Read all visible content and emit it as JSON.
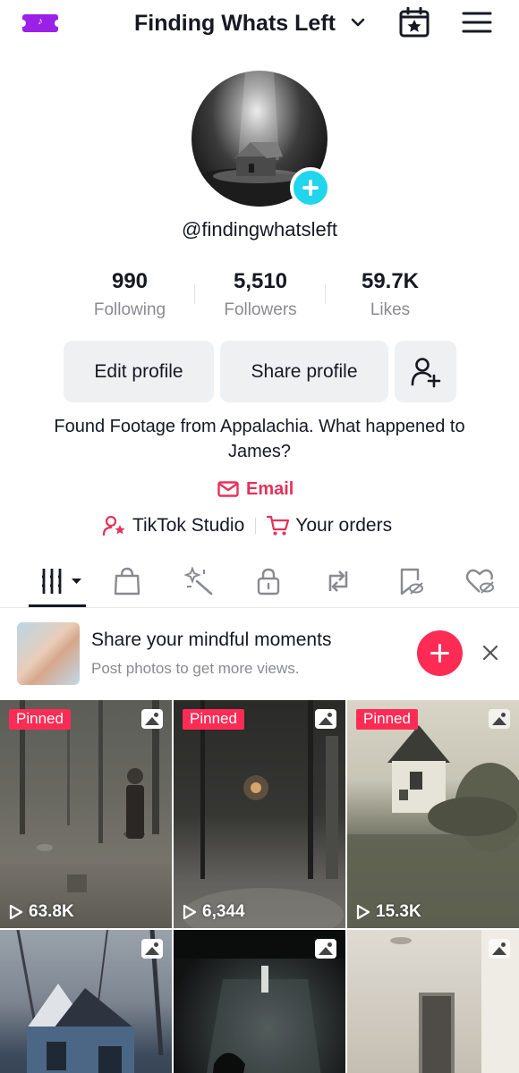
{
  "header": {
    "ticket_glyph": "♪",
    "title": "Finding Whats Left"
  },
  "profile": {
    "handle": "@findingwhatsleft",
    "stats": [
      {
        "value": "990",
        "label": "Following"
      },
      {
        "value": "5,510",
        "label": "Followers"
      },
      {
        "value": "59.7K",
        "label": "Likes"
      }
    ],
    "edit_label": "Edit profile",
    "share_label": "Share profile",
    "bio": "Found Footage from Appalachia. What happened to James?",
    "email_label": "Email",
    "studio_label": "TikTok Studio",
    "orders_label": "Your orders"
  },
  "tabs": [
    "videos-tab",
    "shop-tab",
    "effects-tab",
    "private-tab",
    "reposts-tab",
    "favorites-tab",
    "liked-tab"
  ],
  "banner": {
    "title": "Share your mindful moments",
    "subtitle": "Post photos to get more views."
  },
  "grid": {
    "items": [
      {
        "pinned": "Pinned",
        "views": "63.8K",
        "type": "photo"
      },
      {
        "pinned": "Pinned",
        "views": "6,344",
        "type": "photo"
      },
      {
        "pinned": "Pinned",
        "views": "15.3K",
        "type": "photo"
      },
      {
        "pinned": "",
        "views": "",
        "type": "photo"
      },
      {
        "pinned": "",
        "views": "",
        "type": "photo"
      },
      {
        "pinned": "",
        "views": "",
        "type": "photo"
      }
    ]
  },
  "colors": {
    "accent": "#fe2c55",
    "email": "#e6325a",
    "avatar_add": "#20d5ec",
    "ticket": "#9b21e8"
  }
}
